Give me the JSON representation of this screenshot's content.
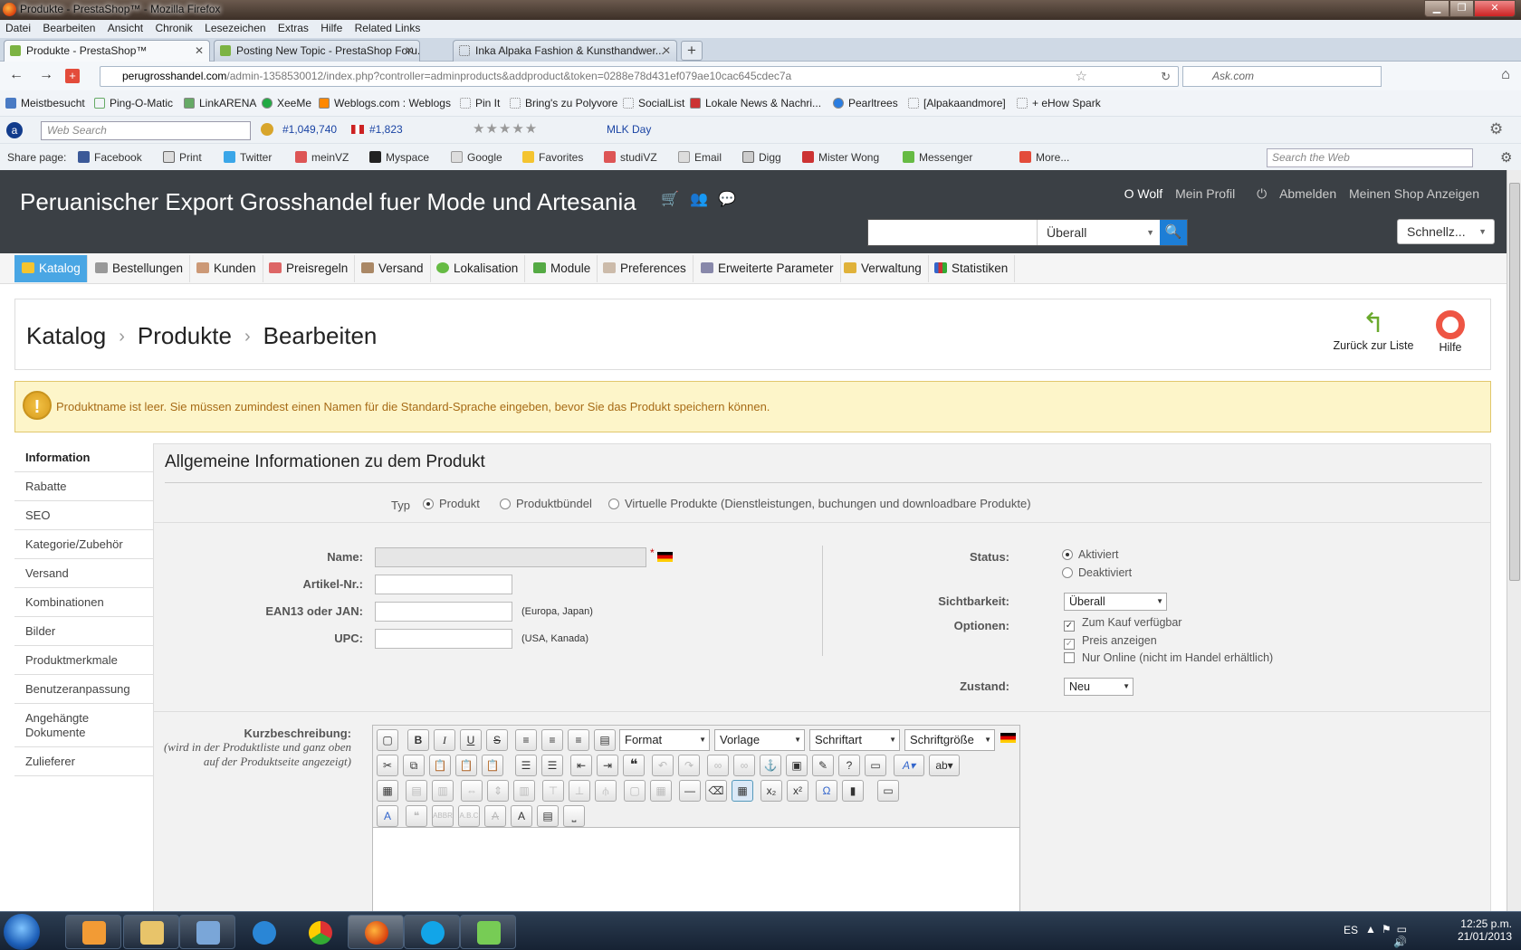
{
  "window": {
    "title": "Produkte - PrestaShop™ - Mozilla Firefox"
  },
  "menu": [
    "Datei",
    "Bearbeiten",
    "Ansicht",
    "Chronik",
    "Lesezeichen",
    "Extras",
    "Hilfe",
    "Related Links"
  ],
  "tabs": [
    {
      "label": "Produkte - PrestaShop™"
    },
    {
      "label": "Posting New Topic - PrestaShop Foru..."
    },
    {
      "label": "Inka Alpaka Fashion & Kunsthandwer..."
    }
  ],
  "newtab_label": "+",
  "url": {
    "domain": "perugrosshandel.com",
    "rest": "/admin-1358530012/index.php?controller=adminproducts&addproduct&token=0288e78d431ef079ae10cac645cdec7a"
  },
  "ask_placeholder": "Ask.com",
  "bookmarks": [
    "Meistbesucht",
    "Ping-O-Matic",
    "LinkARENA",
    "XeeMe",
    "Weblogs.com : Weblogs",
    "Pin It",
    "Bring's zu Polyvore",
    "SocialList",
    "Lokale News & Nachri...",
    "Pearltrees",
    "[Alpakaandmore]",
    "+ eHow Spark"
  ],
  "toolbar": {
    "web_search_placeholder": "Web Search",
    "rank1": "#1,049,740",
    "rank2": "#1,823",
    "mlk": "MLK Day"
  },
  "share": {
    "label": "Share page:",
    "items": [
      "Facebook",
      "Print",
      "Twitter",
      "meinVZ",
      "Myspace",
      "Google",
      "Favorites",
      "studiVZ",
      "Email",
      "Digg",
      "Mister Wong",
      "Messenger",
      "More..."
    ],
    "search_placeholder": "Search the Web"
  },
  "header": {
    "shop_name": "Peruanischer Export Grosshandel fuer Mode und Artesania",
    "links": [
      "O Wolf",
      "Mein Profil",
      "Abmelden",
      "Meinen Shop Anzeigen"
    ],
    "search_scope": "Überall",
    "quick": "Schnellz..."
  },
  "nav": [
    "Katalog",
    "Bestellungen",
    "Kunden",
    "Preisregeln",
    "Versand",
    "Lokalisation",
    "Module",
    "Preferences",
    "Erweiterte Parameter",
    "Verwaltung",
    "Statistiken"
  ],
  "breadcrumb": [
    "Katalog",
    "Produkte",
    "Bearbeiten"
  ],
  "actions": {
    "back": "Zurück zur Liste",
    "help": "Hilfe"
  },
  "alert": "Produktname ist leer. Sie müssen zumindest einen Namen für die Standard-Sprache eingeben, bevor Sie das Produkt speichern können.",
  "sidebar": [
    "Information",
    "Rabatte",
    "SEO",
    "Kategorie/Zubehör",
    "Versand",
    "Kombinationen",
    "Bilder",
    "Produktmerkmale",
    "Benutzeranpassung",
    "Angehängte Dokumente",
    "Zulieferer"
  ],
  "form": {
    "title": "Allgemeine Informationen zu dem Produkt",
    "type_label": "Typ",
    "types": [
      "Produkt",
      "Produktbündel",
      "Virtuelle Produkte (Dienstleistungen, buchungen und downloadbare Produkte)"
    ],
    "name_label": "Name:",
    "name_required": "*",
    "ref_label": "Artikel-Nr.:",
    "ean_label": "EAN13 oder JAN:",
    "ean_hint": "(Europa, Japan)",
    "upc_label": "UPC:",
    "upc_hint": "(USA, Kanada)",
    "status_label": "Status:",
    "status_on": "Aktiviert",
    "status_off": "Deaktiviert",
    "visibility_label": "Sichtbarkeit:",
    "visibility_value": "Überall",
    "options_label": "Optionen:",
    "options": [
      "Zum Kauf verfügbar",
      "Preis anzeigen",
      "Nur Online (nicht im Handel erhältlich)"
    ],
    "condition_label": "Zustand:",
    "condition_value": "Neu",
    "short_desc_label": "Kurzbeschreibung:",
    "short_desc_hint": "(wird in der Produktliste und ganz oben auf der Produktseite angezeigt)"
  },
  "editor": {
    "format": "Format",
    "template": "Vorlage",
    "font": "Schriftart",
    "size": "Schriftgröße"
  },
  "tray": {
    "lang": "ES",
    "time": "12:25 p.m.",
    "date": "21/01/2013"
  }
}
